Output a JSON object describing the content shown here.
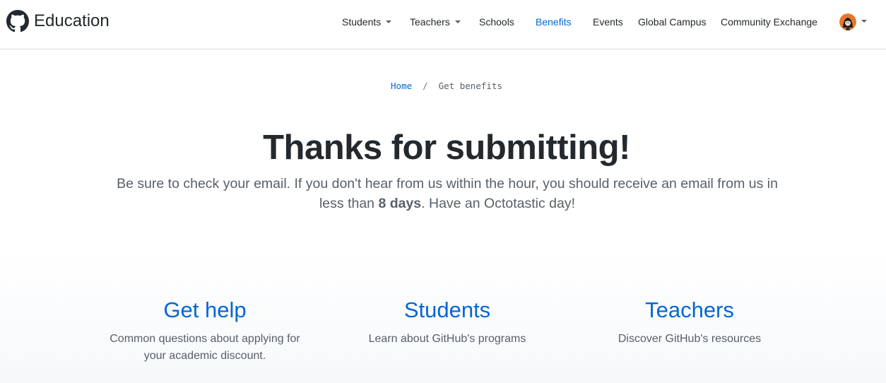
{
  "header": {
    "brand": "Education",
    "nav": [
      {
        "label": "Students",
        "dropdown": true
      },
      {
        "label": "Teachers",
        "dropdown": true
      },
      {
        "label": "Schools",
        "dropdown": false
      },
      {
        "label": "Benefits",
        "dropdown": false,
        "active": true
      },
      {
        "label": "Events",
        "dropdown": false
      },
      {
        "label": "Global Campus",
        "dropdown": false
      },
      {
        "label": "Community Exchange",
        "dropdown": false
      }
    ],
    "avatar_icon": "user-avatar"
  },
  "breadcrumb": {
    "home": "Home",
    "separator": "/",
    "current": "Get benefits"
  },
  "hero": {
    "title": "Thanks for submitting!",
    "subtitle_before": "Be sure to check your email. If you don't hear from us within the hour, you should receive an email from us in less than ",
    "subtitle_bold": "8 days",
    "subtitle_after": ". Have an Octotastic day!"
  },
  "cards": [
    {
      "title": "Get help",
      "description": "Common questions about applying for your academic discount."
    },
    {
      "title": "Students",
      "description": "Learn about GitHub's programs"
    },
    {
      "title": "Teachers",
      "description": "Discover GitHub's resources"
    }
  ],
  "colors": {
    "accent": "#0366d6",
    "text": "#24292e",
    "muted": "#586069"
  }
}
